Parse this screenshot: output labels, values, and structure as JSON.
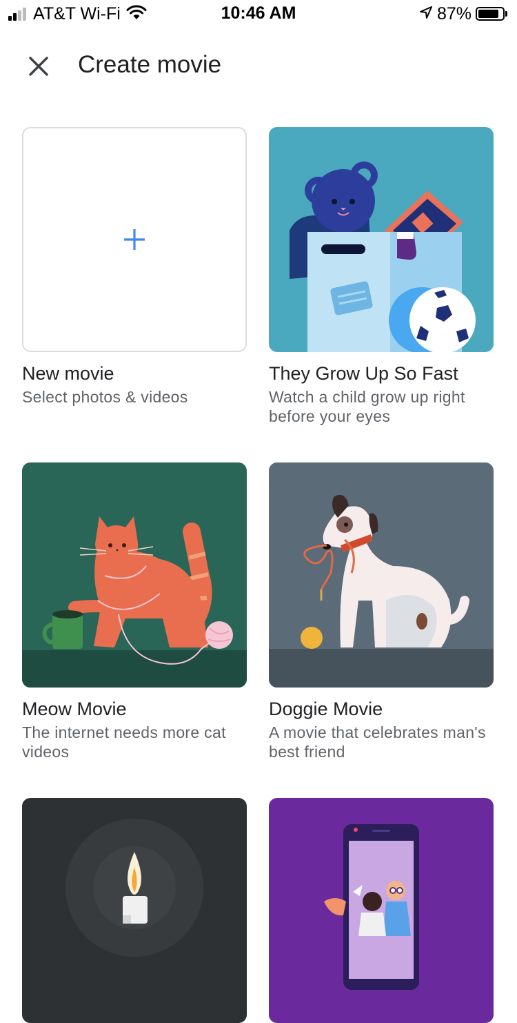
{
  "status_bar": {
    "carrier": "AT&T Wi-Fi",
    "time": "10:46 AM",
    "battery": "87%",
    "battery_level": 0.87
  },
  "header": {
    "title": "Create movie"
  },
  "cards": [
    {
      "title": "New movie",
      "subtitle": "Select photos & videos"
    },
    {
      "title": "They Grow Up So Fast",
      "subtitle": "Watch a child grow up right before your eyes"
    },
    {
      "title": "Meow Movie",
      "subtitle": "The internet needs more cat videos"
    },
    {
      "title": "Doggie Movie",
      "subtitle": "A movie that celebrates man's best friend"
    }
  ],
  "colors": {
    "accent": "#4285f4",
    "grow_bg": "#4aa8bf",
    "meow_bg": "#2a6657",
    "doggie_bg": "#5b6b78",
    "candle_bg": "#2e3133",
    "selfie_bg": "#6a2a9e"
  },
  "icons": [
    "wifi-icon",
    "location-arrow-icon",
    "close-icon",
    "plus-icon"
  ]
}
